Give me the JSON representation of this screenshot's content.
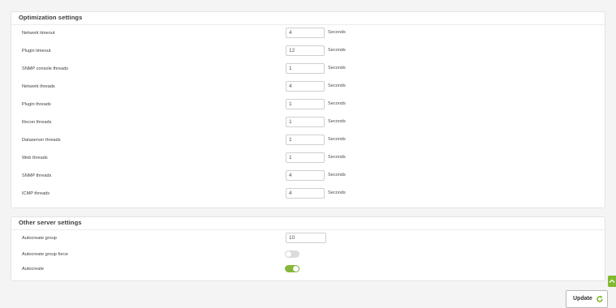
{
  "optimization": {
    "title": "Optimization settings",
    "rows": [
      {
        "label": "Network timeout",
        "value": "4",
        "unit": "Seconds"
      },
      {
        "label": "Plugin timeout",
        "value": "12",
        "unit": "Seconds"
      },
      {
        "label": "SNMP console threads",
        "value": "1",
        "unit": "Seconds"
      },
      {
        "label": "Network threads",
        "value": "4",
        "unit": "Seconds"
      },
      {
        "label": "Plugin threads",
        "value": "1",
        "unit": "Seconds"
      },
      {
        "label": "Recon threads",
        "value": "1",
        "unit": "Seconds"
      },
      {
        "label": "Dataserver threads",
        "value": "1",
        "unit": "Seconds"
      },
      {
        "label": "Web threads",
        "value": "1",
        "unit": "Seconds"
      },
      {
        "label": "SNMP threads",
        "value": "4",
        "unit": "Seconds"
      },
      {
        "label": "ICMP threads",
        "value": "4",
        "unit": "Seconds"
      }
    ]
  },
  "other": {
    "title": "Other server settings",
    "autocreate_group": {
      "label": "Autocreate group",
      "value": "10"
    },
    "autocreate_group_force": {
      "label": "Autocreate group force",
      "enabled": false
    },
    "autocreate": {
      "label": "Autocreate",
      "enabled": true
    }
  },
  "actions": {
    "update_label": "Update"
  },
  "icons": {
    "scroll_top": "chevron-up-icon",
    "update": "refresh-icon"
  },
  "colors": {
    "accent": "#82b92e",
    "toggle_on": "#86b73a",
    "toggle_off": "#dcdcdc"
  }
}
